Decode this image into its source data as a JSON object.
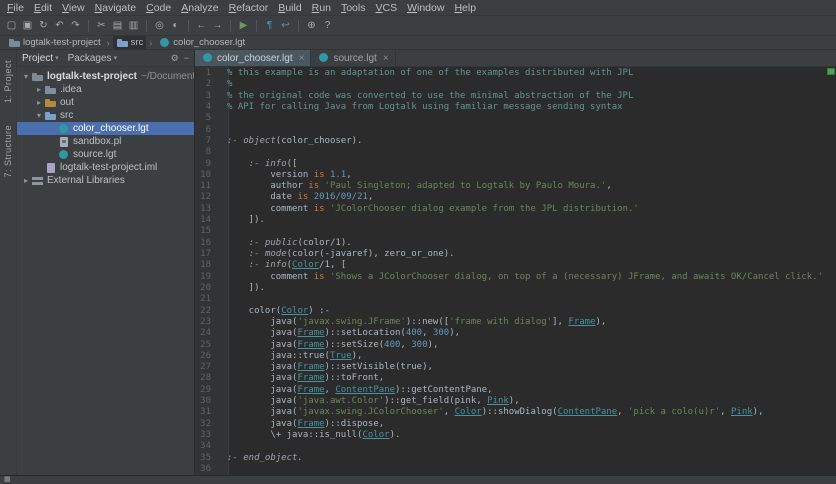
{
  "colors": {
    "chrome_bg": "#3c3f41",
    "editor_bg": "#2b2b2b",
    "selection_blue": "#4b6eaf",
    "inspection_ok": "#4da34d"
  },
  "menu_bar": {
    "items": [
      "File",
      "Edit",
      "View",
      "Navigate",
      "Code",
      "Analyze",
      "Refactor",
      "Build",
      "Run",
      "Tools",
      "VCS",
      "Window",
      "Help"
    ]
  },
  "toolbar": {
    "icons": [
      {
        "name": "open-project",
        "glyph": "▢"
      },
      {
        "name": "save-all",
        "glyph": "▣"
      },
      {
        "name": "synchronize",
        "glyph": "↻"
      },
      {
        "name": "undo",
        "glyph": "↶"
      },
      {
        "name": "redo",
        "glyph": "↷"
      },
      {
        "name": "sep"
      },
      {
        "name": "cut",
        "glyph": "✂"
      },
      {
        "name": "copy",
        "glyph": "▤"
      },
      {
        "name": "paste",
        "glyph": "▥"
      },
      {
        "name": "sep"
      },
      {
        "name": "find",
        "glyph": "◎"
      },
      {
        "name": "replace",
        "glyph": "◐"
      },
      {
        "name": "sep"
      },
      {
        "name": "back",
        "glyph": "←"
      },
      {
        "name": "forward",
        "glyph": "→"
      },
      {
        "name": "sep"
      },
      {
        "name": "run",
        "glyph": "▶",
        "color": "#6a9a5f"
      },
      {
        "name": "sep"
      },
      {
        "name": "pilcrow",
        "glyph": "¶",
        "color": "#4f94b5"
      },
      {
        "name": "soft-wrap",
        "glyph": "↩",
        "color": "#4f94b5"
      },
      {
        "name": "sep"
      },
      {
        "name": "settings",
        "glyph": "⊕"
      },
      {
        "name": "help",
        "glyph": "?"
      }
    ]
  },
  "breadcrumbs": {
    "items": [
      {
        "label": "logtalk-test-project",
        "icon": "project"
      },
      {
        "label": "src",
        "icon": "folder-src",
        "highlight": true
      },
      {
        "label": "color_chooser.lgt",
        "icon": "file-lgt"
      }
    ]
  },
  "tool_strip": {
    "labels": [
      "1: Project",
      "7: Structure"
    ]
  },
  "project_panel": {
    "tabs": [
      "Project",
      "Packages"
    ],
    "header_icons": [
      {
        "name": "settings",
        "glyph": "⚙"
      },
      {
        "name": "hide-panel",
        "glyph": "−"
      }
    ],
    "tree": [
      {
        "label": "logtalk-test-project",
        "suffix": "~/Documents...",
        "indent": 0,
        "chevron": "▾",
        "icon": "project",
        "bold": true
      },
      {
        "label": ".idea",
        "indent": 1,
        "chevron": "▸",
        "icon": "folder"
      },
      {
        "label": "out",
        "indent": 1,
        "chevron": "▸",
        "icon": "folder-excluded"
      },
      {
        "label": "src",
        "indent": 1,
        "chevron": "▾",
        "icon": "folder-src"
      },
      {
        "label": "color_chooser.lgt",
        "indent": 2,
        "chevron": "",
        "icon": "file-lgt",
        "selected": true
      },
      {
        "label": "sandbox.pl",
        "indent": 2,
        "chevron": "",
        "icon": "file-pl"
      },
      {
        "label": "source.lgt",
        "indent": 2,
        "chevron": "",
        "icon": "file-lgt"
      },
      {
        "label": "logtalk-test-project.iml",
        "indent": 1,
        "chevron": "",
        "icon": "file-iml"
      },
      {
        "label": "External Libraries",
        "indent": 0,
        "chevron": "▸",
        "icon": "libraries"
      }
    ]
  },
  "editor": {
    "tabs": [
      {
        "label": "color_chooser.lgt",
        "icon": "file-lgt",
        "active": true,
        "close": "×"
      },
      {
        "label": "source.lgt",
        "icon": "file-lgt",
        "active": false,
        "close": "×"
      }
    ],
    "lines": [
      [
        [
          "c",
          "% this example is an adaptation of one of the examples distributed with JPL"
        ]
      ],
      [
        [
          "c",
          "%"
        ]
      ],
      [
        [
          "c",
          "% the original code was converted to use the minimal abstraction of the JPL"
        ]
      ],
      [
        [
          "c",
          "% API for calling Java from Logtalk using familiar message sending syntax"
        ]
      ],
      [],
      [],
      [
        [
          "d",
          ":- object"
        ],
        [
          "p",
          "(color_chooser)."
        ]
      ],
      [],
      [
        [
          "p",
          "    "
        ],
        [
          "d",
          ":- info"
        ],
        [
          "p",
          "(["
        ]
      ],
      [
        [
          "p",
          "        version "
        ],
        [
          "k",
          "is"
        ],
        [
          "p",
          " "
        ],
        [
          "n",
          "1.1"
        ],
        [
          "p",
          ","
        ]
      ],
      [
        [
          "p",
          "        author "
        ],
        [
          "k",
          "is"
        ],
        [
          "p",
          " "
        ],
        [
          "s",
          "'Paul Singleton; adapted to Logtalk by Paulo Moura.'"
        ],
        [
          "p",
          ","
        ]
      ],
      [
        [
          "p",
          "        date "
        ],
        [
          "k",
          "is"
        ],
        [
          "p",
          " "
        ],
        [
          "n",
          "2016/09/21"
        ],
        [
          "p",
          ","
        ]
      ],
      [
        [
          "p",
          "        comment "
        ],
        [
          "k",
          "is"
        ],
        [
          "p",
          " "
        ],
        [
          "s",
          "'JColorChooser dialog example from the JPL distribution.'"
        ]
      ],
      [
        [
          "p",
          "    ])."
        ]
      ],
      [],
      [
        [
          "p",
          "    "
        ],
        [
          "d",
          ":- public"
        ],
        [
          "p",
          "(color/1)."
        ]
      ],
      [
        [
          "p",
          "    "
        ],
        [
          "d",
          ":- mode"
        ],
        [
          "p",
          "(color(-javaref), zero_or_one)."
        ]
      ],
      [
        [
          "p",
          "    "
        ],
        [
          "d",
          ":- info"
        ],
        [
          "p",
          "("
        ],
        [
          "v",
          "Color"
        ],
        [
          "p",
          "/1, ["
        ]
      ],
      [
        [
          "p",
          "        comment "
        ],
        [
          "k",
          "is"
        ],
        [
          "p",
          " "
        ],
        [
          "s",
          "'Shows a JColorChooser dialog, on top of a (necessary) JFrame, and awaits OK/Cancel click.'"
        ]
      ],
      [
        [
          "p",
          "    ])."
        ]
      ],
      [],
      [
        [
          "p",
          "    color("
        ],
        [
          "v",
          "Color"
        ],
        [
          "p",
          ") :-"
        ]
      ],
      [
        [
          "p",
          "        java("
        ],
        [
          "s",
          "'javax.swing.JFrame'"
        ],
        [
          "p",
          ")::new(["
        ],
        [
          "s",
          "'frame with dialog'"
        ],
        [
          "p",
          "], "
        ],
        [
          "v",
          "Frame"
        ],
        [
          "p",
          "),"
        ]
      ],
      [
        [
          "p",
          "        java("
        ],
        [
          "v",
          "Frame"
        ],
        [
          "p",
          ")::setLocation("
        ],
        [
          "n",
          "400"
        ],
        [
          "p",
          ", "
        ],
        [
          "n",
          "300"
        ],
        [
          "p",
          "),"
        ]
      ],
      [
        [
          "p",
          "        java("
        ],
        [
          "v",
          "Frame"
        ],
        [
          "p",
          ")::setSize("
        ],
        [
          "n",
          "400"
        ],
        [
          "p",
          ", "
        ],
        [
          "n",
          "300"
        ],
        [
          "p",
          "),"
        ]
      ],
      [
        [
          "p",
          "        java::true("
        ],
        [
          "v",
          "True"
        ],
        [
          "p",
          "),"
        ]
      ],
      [
        [
          "p",
          "        java("
        ],
        [
          "v",
          "Frame"
        ],
        [
          "p",
          ")::setVisible(true),"
        ]
      ],
      [
        [
          "p",
          "        java("
        ],
        [
          "v",
          "Frame"
        ],
        [
          "p",
          ")::toFront,"
        ]
      ],
      [
        [
          "p",
          "        java("
        ],
        [
          "v",
          "Frame"
        ],
        [
          "p",
          ", "
        ],
        [
          "v",
          "ContentPane"
        ],
        [
          "p",
          ")::getContentPane,"
        ]
      ],
      [
        [
          "p",
          "        java("
        ],
        [
          "s",
          "'java.awt.Color'"
        ],
        [
          "p",
          ")::get_field(pink, "
        ],
        [
          "v",
          "Pink"
        ],
        [
          "p",
          "),"
        ]
      ],
      [
        [
          "p",
          "        java("
        ],
        [
          "s",
          "'javax.swing.JColorChooser'"
        ],
        [
          "p",
          ", "
        ],
        [
          "v",
          "Color"
        ],
        [
          "p",
          ")::showDialog("
        ],
        [
          "v",
          "ContentPane"
        ],
        [
          "p",
          ", "
        ],
        [
          "s",
          "'pick a colo(u)r'"
        ],
        [
          "p",
          ", "
        ],
        [
          "v",
          "Pink"
        ],
        [
          "p",
          "),"
        ]
      ],
      [
        [
          "p",
          "        java("
        ],
        [
          "v",
          "Frame"
        ],
        [
          "p",
          ")::dispose,"
        ]
      ],
      [
        [
          "p",
          "        \\+ java::is_null("
        ],
        [
          "v",
          "Color"
        ],
        [
          "p",
          ")."
        ]
      ],
      [],
      [
        [
          "d",
          ":- end_object."
        ]
      ],
      []
    ]
  },
  "status_bar": {
    "icons": [
      {
        "name": "toolwindow-toggle",
        "glyph": "▦"
      }
    ]
  }
}
